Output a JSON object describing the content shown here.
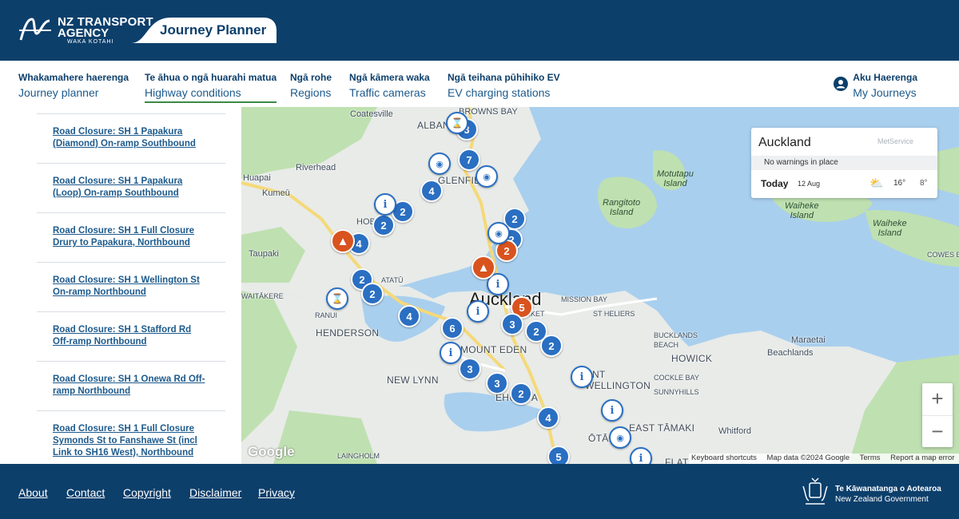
{
  "header": {
    "logo_line1": "NZ TRANSPORT",
    "logo_line2": "AGENCY",
    "logo_line3": "WAKA KOTAHI",
    "app_title": "Journey Planner"
  },
  "nav": {
    "items": [
      {
        "maori": "Whakamahere haerenga",
        "english": "Journey planner"
      },
      {
        "maori": "Te āhua o ngā huarahi matua",
        "english": "Highway conditions"
      },
      {
        "maori": "Ngā rohe",
        "english": "Regions"
      },
      {
        "maori": "Ngā kāmera waka",
        "english": "Traffic cameras"
      },
      {
        "maori": "Ngā teihana pūhihiko EV",
        "english": "EV charging stations"
      }
    ],
    "account": {
      "maori": "Aku Haerenga",
      "english": "My Journeys",
      "icon": "user-circle-icon"
    }
  },
  "closures": [
    {
      "line1": "Road Closure: SH 1 Papakura",
      "line2": "(Diamond) On-ramp Southbound"
    },
    {
      "line1": "Road Closure: SH 1 Papakura",
      "line2": "(Loop) On-ramp Southbound"
    },
    {
      "line1": "Road Closure: SH 1 Full Closure",
      "line2": "Drury to Papakura, Northbound"
    },
    {
      "line1": "Road Closure: SH 1 Wellington St",
      "line2": "On-ramp Northbound"
    },
    {
      "line1": "Road Closure: SH 1 Stafford Rd",
      "line2": "Off-ramp Northbound"
    },
    {
      "line1": "Road Closure: SH 1 Onewa Rd Off-",
      "line2": "ramp Northbound"
    },
    {
      "line1": "Road Closure: SH 1 Full Closure",
      "line2": "Symonds St to Fanshawe St (incl",
      "line3": "Link to SH16 West), Northbound"
    }
  ],
  "map": {
    "places": {
      "browns_bay": "BROWNS BAY",
      "albany": "ALBANY",
      "coatesville": "Coatesville",
      "riverhead": "Riverhead",
      "huapai": "Huapai",
      "kumeu": "Kumeū",
      "glenfield": "GLENFIELD",
      "hobsonville": "HOB",
      "taupaki": "Taupaki",
      "waitakere": "WAITĀKERE",
      "ranui": "RANUI",
      "atatu": "ATATŪ",
      "henderson": "HENDERSON",
      "new_lynn": "NEW LYNN",
      "mount_eden": "MOUNT EDEN",
      "auckland": "Auckland",
      "mission_bay": "MISSION BAY",
      "st_heliers": "ST HELIERS",
      "newmarket": "MARKET",
      "onehunga": "EHUNGA",
      "mount_wellington": "UNT\nWELLINGTON",
      "otahuhu": "ŌTĀHU",
      "east_tamaki": "EAST TĀMAKI",
      "flat_bush": "FLAT",
      "laingholm": "LAINGHOLM",
      "howick": "HOWICK",
      "bucklands_beach": "BUCKLANDS\nBEACH",
      "cockle_bay": "COCKLE BAY",
      "sunnyhills": "SUNNYHILLS",
      "maraetai": "Maraetai",
      "beachlands": "Beachlands",
      "whitford": "Whitford",
      "cowes_bay": "COWES BAY",
      "motutapu": "Motutapu\nIsland",
      "rangitoto": "Rangitoto\nIsland",
      "waiheke_1": "Waiheke\nIsland",
      "waiheke_2": "Waiheke\nIsland"
    },
    "markers": [
      {
        "label": "3",
        "kind": "cluster"
      },
      {
        "label": "7",
        "kind": "cluster"
      },
      {
        "label": "4",
        "kind": "cluster"
      },
      {
        "label": "2",
        "kind": "cluster"
      },
      {
        "label": "2",
        "kind": "cluster"
      },
      {
        "label": "4",
        "kind": "cluster"
      },
      {
        "label": "2",
        "kind": "cluster"
      },
      {
        "label": "2",
        "kind": "cluster"
      },
      {
        "label": "2",
        "kind": "incident"
      },
      {
        "label": "2",
        "kind": "cluster"
      },
      {
        "label": "2",
        "kind": "cluster"
      },
      {
        "label": "4",
        "kind": "cluster"
      },
      {
        "label": "5",
        "kind": "incident"
      },
      {
        "label": "6",
        "kind": "cluster"
      },
      {
        "label": "3",
        "kind": "cluster"
      },
      {
        "label": "2",
        "kind": "cluster"
      },
      {
        "label": "2",
        "kind": "cluster"
      },
      {
        "label": "3",
        "kind": "cluster"
      },
      {
        "label": "3",
        "kind": "cluster"
      },
      {
        "label": "2",
        "kind": "cluster"
      },
      {
        "label": "4",
        "kind": "cluster"
      },
      {
        "label": "5",
        "kind": "cluster"
      },
      {
        "label": "i",
        "kind": "info"
      },
      {
        "label": "i",
        "kind": "info"
      },
      {
        "label": "i",
        "kind": "info"
      },
      {
        "label": "i",
        "kind": "info"
      },
      {
        "label": "i",
        "kind": "info"
      },
      {
        "label": "i",
        "kind": "info"
      },
      {
        "label": "i",
        "kind": "info"
      }
    ],
    "weather": {
      "city": "Auckland",
      "brand": "MetService",
      "warning": "No warnings in place",
      "day": "Today",
      "date": "12 Aug",
      "high": "16°",
      "low": "8°",
      "icon": "partly-cloudy-rain-icon"
    },
    "zoom_in": "+",
    "zoom_out": "−",
    "google": "Google",
    "attribution": [
      "Keyboard shortcuts",
      "Map data ©2024 Google",
      "Terms",
      "Report a map error"
    ],
    "colors": {
      "water": "#a9cfee",
      "land": "#e8ebe8",
      "park": "#bfe0b0",
      "cluster": "#2a6fc2",
      "incident": "#d9531e"
    }
  },
  "footer": {
    "links": [
      "About",
      "Contact",
      "Copyright",
      "Disclaimer",
      "Privacy"
    ],
    "gov_maori": "Te Kāwanatanga o Aotearoa",
    "gov_english": "New Zealand Government"
  }
}
